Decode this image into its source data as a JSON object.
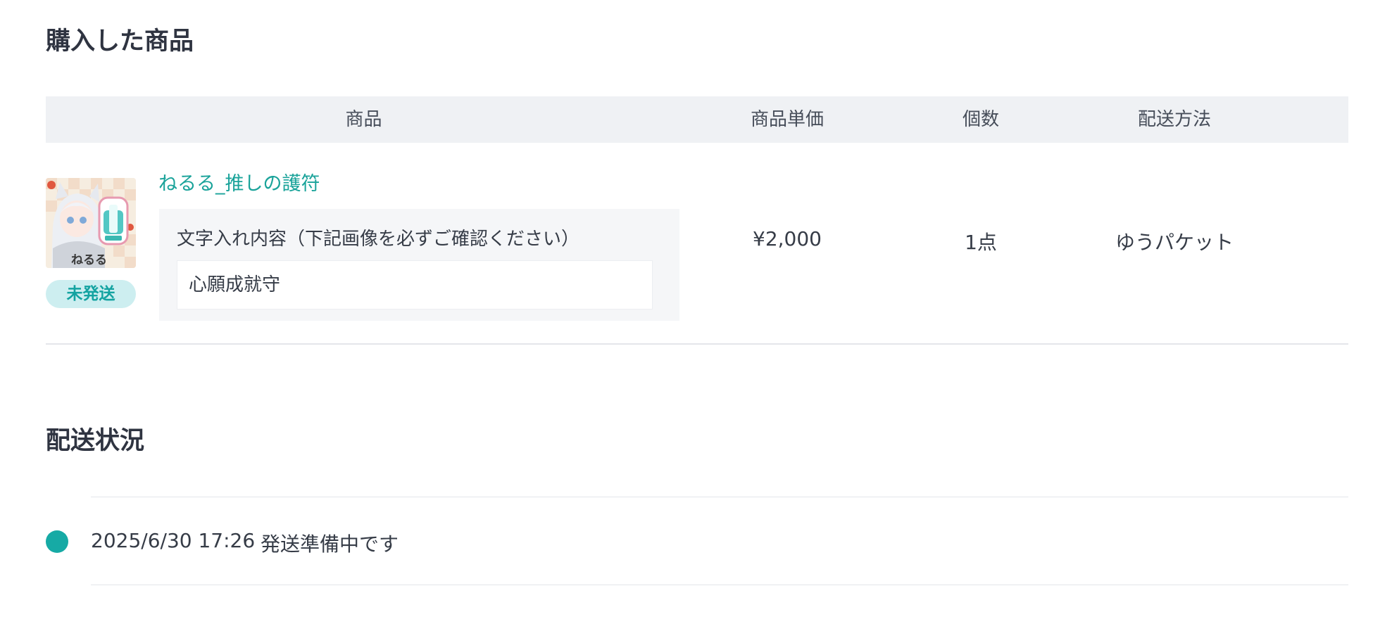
{
  "purchased_section": {
    "title": "購入した商品"
  },
  "table": {
    "headers": {
      "product": "商品",
      "unit_price": "商品単価",
      "quantity": "個数",
      "shipping_method": "配送方法"
    },
    "rows": [
      {
        "product_name": "ねるる_推しの護符",
        "thumbnail_caption": "ねるる",
        "status_badge": "未発送",
        "engraving_label": "文字入れ内容（下記画像を必ずご確認ください）",
        "engraving_value": "心願成就守",
        "unit_price": "¥2,000",
        "quantity": "1点",
        "shipping_method": "ゆうパケット"
      }
    ]
  },
  "shipping_section": {
    "title": "配送状況",
    "events": [
      {
        "datetime": "2025/6/30 17:26",
        "status": "発送準備中です"
      }
    ]
  },
  "colors": {
    "accent": "#1aa39a",
    "badge_bg": "#cdeef0",
    "header_bg": "#eff1f4",
    "timeline_dot": "#16aaa5"
  }
}
